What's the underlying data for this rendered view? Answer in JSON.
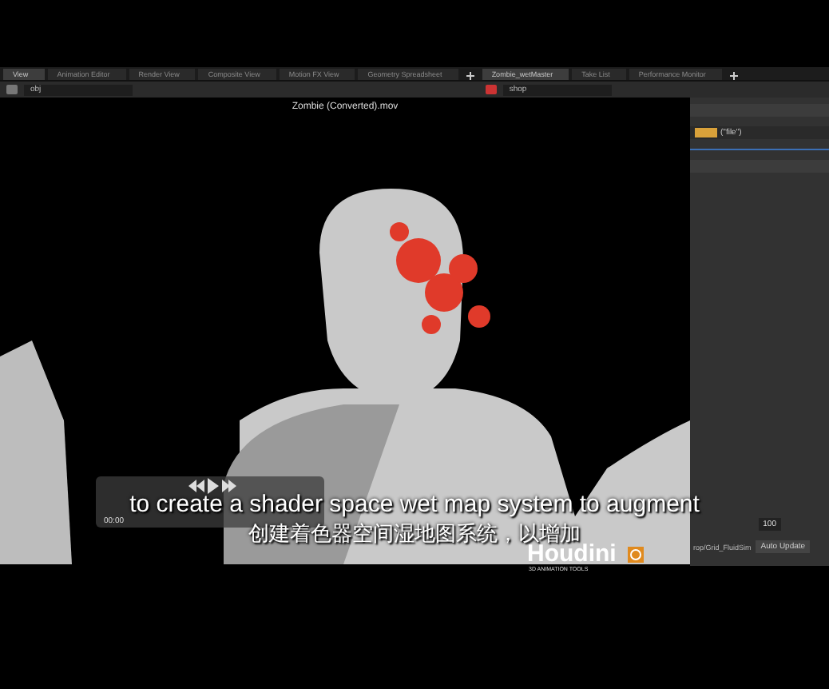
{
  "left_pane": {
    "tabs": [
      {
        "label": "View",
        "selected": true
      },
      {
        "label": "Animation Editor",
        "selected": false
      },
      {
        "label": "Render View",
        "selected": false
      },
      {
        "label": "Composite View",
        "selected": false
      },
      {
        "label": "Motion FX View",
        "selected": false
      },
      {
        "label": "Geometry Spreadsheet",
        "selected": false
      }
    ],
    "path": "obj"
  },
  "right_pane": {
    "tabs": [
      {
        "label": "Zombie_wetMaster",
        "selected": true
      },
      {
        "label": "Take List",
        "selected": false
      },
      {
        "label": "Performance Monitor",
        "selected": false
      }
    ],
    "path": "shop"
  },
  "viewer": {
    "title": "Zombie (Converted).mov"
  },
  "parameters": {
    "expression": "(\"file\")",
    "frame_value": "100",
    "node_path": "rop/Grid_FluidSim",
    "update_button": "Auto Update"
  },
  "video_player": {
    "time": "00:00"
  },
  "subtitles": {
    "english": "to create a shader space wet map system to augment",
    "chinese": "创建着色器空间湿地图系统，以增加"
  },
  "logo": {
    "name": "Houdini",
    "tagline": "3D ANIMATION TOOLS"
  }
}
